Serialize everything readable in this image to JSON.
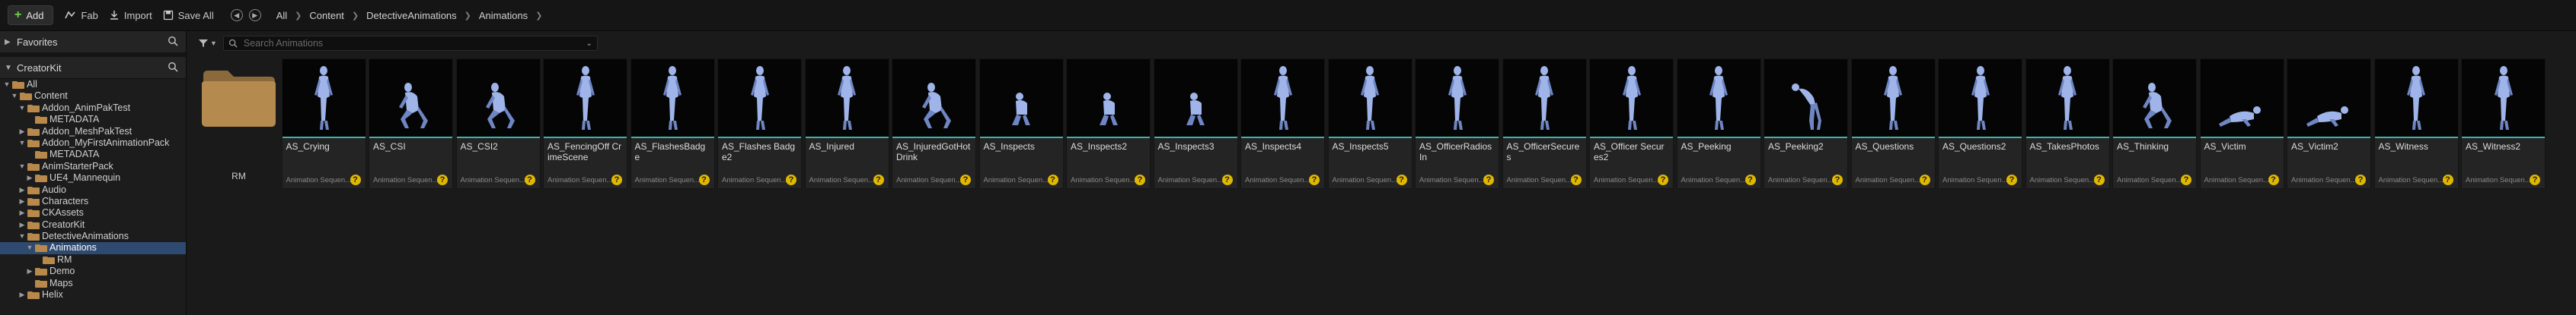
{
  "toolbar": {
    "add_label": "Add",
    "fab_label": "Fab",
    "import_label": "Import",
    "save_all_label": "Save All",
    "breadcrumbs": [
      "All",
      "Content",
      "DetectiveAnimations",
      "Animations"
    ]
  },
  "left_panel": {
    "favorites_label": "Favorites",
    "creatorkit_label": "CreatorKit",
    "tree": [
      {
        "label": "All",
        "depth": 0,
        "arrow": "down"
      },
      {
        "label": "Content",
        "depth": 1,
        "arrow": "down"
      },
      {
        "label": "Addon_AnimPakTest",
        "depth": 2,
        "arrow": "down"
      },
      {
        "label": "METADATA",
        "depth": 3,
        "arrow": ""
      },
      {
        "label": "Addon_MeshPakTest",
        "depth": 2,
        "arrow": "right"
      },
      {
        "label": "Addon_MyFirstAnimationPack",
        "depth": 2,
        "arrow": "down"
      },
      {
        "label": "METADATA",
        "depth": 3,
        "arrow": ""
      },
      {
        "label": "AnimStarterPack",
        "depth": 2,
        "arrow": "down"
      },
      {
        "label": "UE4_Mannequin",
        "depth": 3,
        "arrow": "right"
      },
      {
        "label": "Audio",
        "depth": 2,
        "arrow": "right"
      },
      {
        "label": "Characters",
        "depth": 2,
        "arrow": "right"
      },
      {
        "label": "CKAssets",
        "depth": 2,
        "arrow": "right"
      },
      {
        "label": "CreatorKit",
        "depth": 2,
        "arrow": "right"
      },
      {
        "label": "DetectiveAnimations",
        "depth": 2,
        "arrow": "down"
      },
      {
        "label": "Animations",
        "depth": 3,
        "arrow": "down",
        "selected": true
      },
      {
        "label": "RM",
        "depth": 4,
        "arrow": ""
      },
      {
        "label": "Demo",
        "depth": 3,
        "arrow": "right"
      },
      {
        "label": "Maps",
        "depth": 3,
        "arrow": ""
      },
      {
        "label": "Helix",
        "depth": 2,
        "arrow": "right"
      }
    ]
  },
  "search": {
    "placeholder": "Search Animations"
  },
  "folder": {
    "label": "RM"
  },
  "asset_type_label": "Animation Sequen...",
  "assets": [
    {
      "name": "AS_Crying",
      "pose": "stand"
    },
    {
      "name": "AS_CSI",
      "pose": "crouch"
    },
    {
      "name": "AS_CSI2",
      "pose": "crouch"
    },
    {
      "name": "AS_FencingOff CrimeScene",
      "pose": "stand"
    },
    {
      "name": "AS_FlashesBadge",
      "pose": "stand"
    },
    {
      "name": "AS_Flashes Badge2",
      "pose": "stand"
    },
    {
      "name": "AS_Injured",
      "pose": "stand"
    },
    {
      "name": "AS_InjuredGotHot Drink",
      "pose": "crouch"
    },
    {
      "name": "AS_Inspects",
      "pose": "low"
    },
    {
      "name": "AS_Inspects2",
      "pose": "low"
    },
    {
      "name": "AS_Inspects3",
      "pose": "low"
    },
    {
      "name": "AS_Inspects4",
      "pose": "stand"
    },
    {
      "name": "AS_Inspects5",
      "pose": "stand"
    },
    {
      "name": "AS_OfficerRadios In",
      "pose": "stand"
    },
    {
      "name": "AS_OfficerSecures",
      "pose": "stand"
    },
    {
      "name": "AS_Officer Secures2",
      "pose": "stand"
    },
    {
      "name": "AS_Peeking",
      "pose": "stand"
    },
    {
      "name": "AS_Peeking2",
      "pose": "bend"
    },
    {
      "name": "AS_Questions",
      "pose": "stand"
    },
    {
      "name": "AS_Questions2",
      "pose": "stand"
    },
    {
      "name": "AS_TakesPhotos",
      "pose": "stand"
    },
    {
      "name": "AS_Thinking",
      "pose": "crouch"
    },
    {
      "name": "AS_Victim",
      "pose": "lying"
    },
    {
      "name": "AS_Victim2",
      "pose": "lying"
    },
    {
      "name": "AS_Witness",
      "pose": "stand"
    },
    {
      "name": "AS_Witness2",
      "pose": "stand"
    }
  ]
}
